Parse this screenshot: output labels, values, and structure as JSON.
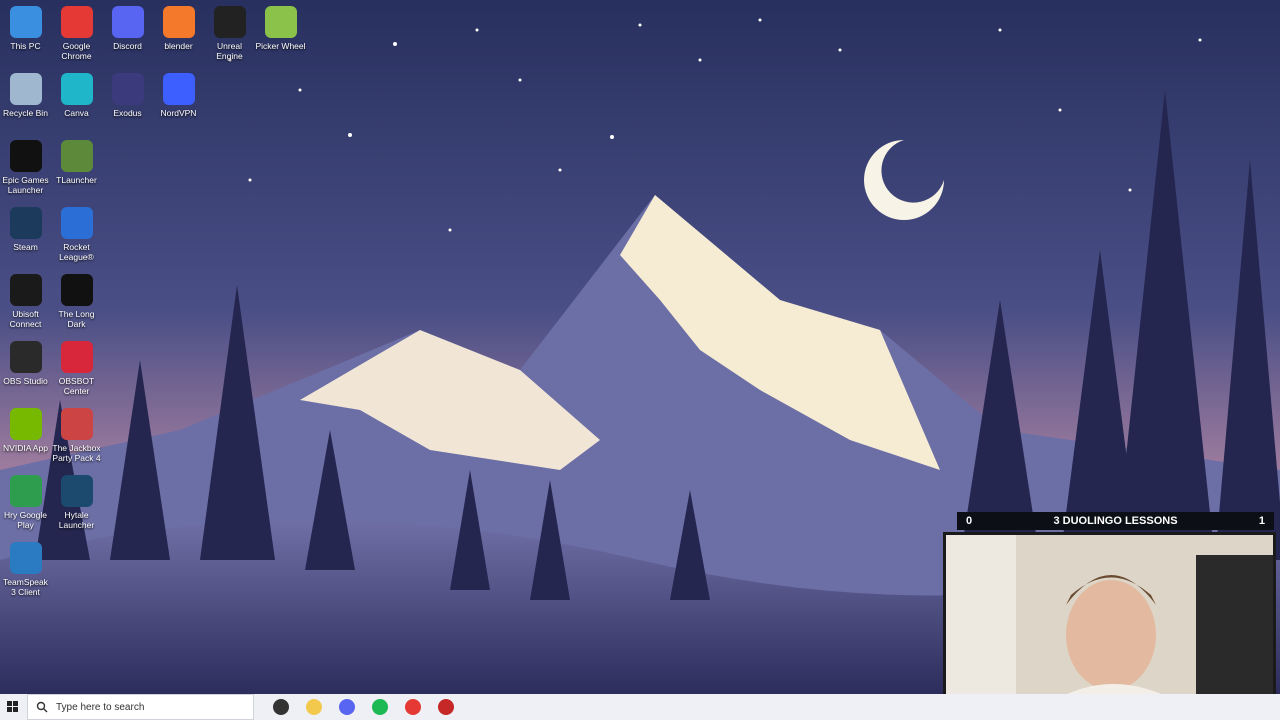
{
  "desktop": {
    "icons": [
      {
        "label": "This PC",
        "icon": "monitor-icon",
        "color": "#3b8fe0"
      },
      {
        "label": "Google Chrome",
        "icon": "chrome-icon",
        "color": "#e53935"
      },
      {
        "label": "Discord",
        "icon": "discord-icon",
        "color": "#5865f2"
      },
      {
        "label": "blender",
        "icon": "blender-icon",
        "color": "#f5792a"
      },
      {
        "label": "Unreal Engine",
        "icon": "unreal-icon",
        "color": "#222222"
      },
      {
        "label": "Picker Wheel",
        "icon": "wheel-icon",
        "color": "#8bc34a"
      },
      {
        "label": "Recycle Bin",
        "icon": "recycle-bin-icon",
        "color": "#9fb7cf"
      },
      {
        "label": "Canva",
        "icon": "canva-icon",
        "color": "#1fb6c9"
      },
      {
        "label": "Exodus",
        "icon": "exodus-icon",
        "color": "#3a3a7c"
      },
      {
        "label": "NordVPN",
        "icon": "nordvpn-icon",
        "color": "#3e5fff"
      },
      {
        "label": "Epic Games Launcher",
        "icon": "epic-icon",
        "color": "#111111"
      },
      {
        "label": "TLauncher",
        "icon": "minecraft-icon",
        "color": "#5d8a3a"
      },
      {
        "label": "Steam",
        "icon": "steam-icon",
        "color": "#1b3a5c"
      },
      {
        "label": "Rocket League®",
        "icon": "rocket-league-icon",
        "color": "#2b6fd6"
      },
      {
        "label": "Ubisoft Connect",
        "icon": "ubisoft-icon",
        "color": "#1a1a1a"
      },
      {
        "label": "The Long Dark",
        "icon": "long-dark-icon",
        "color": "#111111"
      },
      {
        "label": "OBS Studio",
        "icon": "obs-icon",
        "color": "#2a2a2a"
      },
      {
        "label": "OBSBOT Center",
        "icon": "obsbot-icon",
        "color": "#d8263a"
      },
      {
        "label": "NVIDIA App",
        "icon": "nvidia-icon",
        "color": "#76b900"
      },
      {
        "label": "The Jackbox Party Pack 4",
        "icon": "jackbox-icon",
        "color": "#c44"
      },
      {
        "label": "Hry Google Play",
        "icon": "google-play-icon",
        "color": "#2e9e4e"
      },
      {
        "label": "Hytale Launcher",
        "icon": "hytale-icon",
        "color": "#1c4a6e"
      },
      {
        "label": "TeamSpeak 3 Client",
        "icon": "teamspeak-icon",
        "color": "#2a7bc2"
      }
    ]
  },
  "overlay": {
    "left_count": "0",
    "title": "3 DUOLINGO LESSONS",
    "right_count": "1"
  },
  "taskbar": {
    "search_placeholder": "Type here to search",
    "apps": [
      {
        "name": "task-view-icon",
        "color": "#333"
      },
      {
        "name": "file-explorer-icon",
        "color": "#f2c94c"
      },
      {
        "name": "discord-taskbar-icon",
        "color": "#5865f2"
      },
      {
        "name": "spotify-icon",
        "color": "#1db954"
      },
      {
        "name": "chrome-taskbar-icon",
        "color": "#e53935"
      },
      {
        "name": "app-taskbar-icon",
        "color": "#c62828"
      }
    ]
  },
  "colors": {
    "sky_top": "#2b3566",
    "sky_bottom": "#c98ea3",
    "snow": "#f6ecd3",
    "tree": "#2a2c58"
  }
}
